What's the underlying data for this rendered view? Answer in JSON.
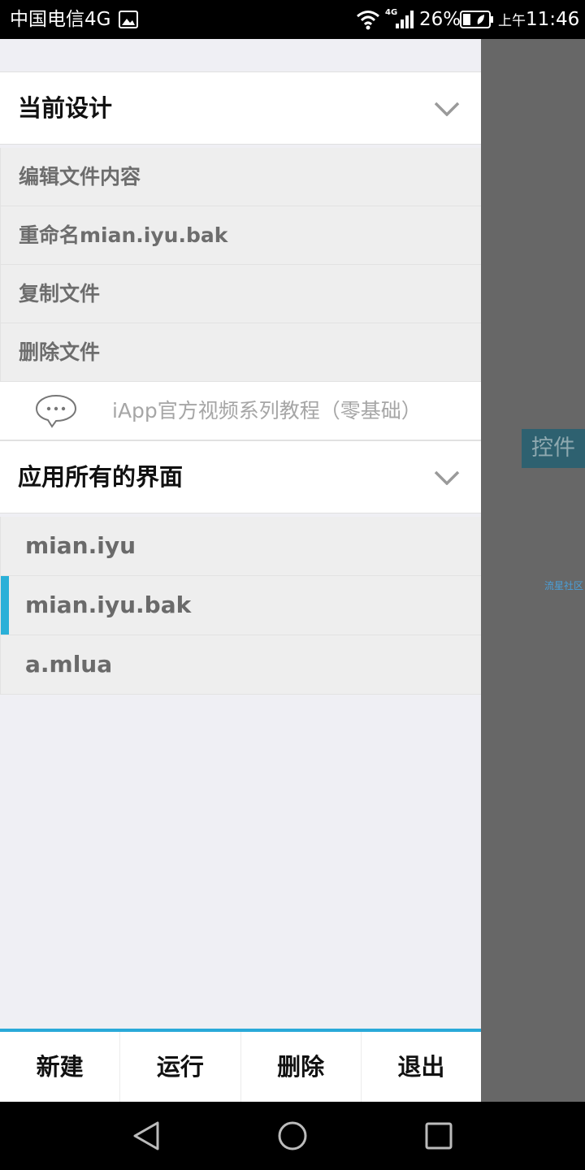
{
  "status_bar": {
    "carrier": "中国电信4G",
    "net_type": "4G",
    "battery": "26%",
    "time_ampm": "上午",
    "time": "11:46"
  },
  "drawer": {
    "current_design": {
      "title": "当前设计",
      "items": [
        {
          "label": "编辑文件内容"
        },
        {
          "label": "重命名mian.iyu.bak"
        },
        {
          "label": "复制文件"
        },
        {
          "label": "删除文件"
        }
      ]
    },
    "promo": {
      "label": "iApp官方视频系列教程（零基础）"
    },
    "all_screens": {
      "title": "应用所有的界面",
      "files": [
        {
          "label": "mian.iyu",
          "selected": false
        },
        {
          "label": "mian.iyu.bak",
          "selected": true
        },
        {
          "label": "a.mlua",
          "selected": false
        }
      ]
    }
  },
  "toolbar": {
    "new_label": "新建",
    "run_label": "运行",
    "delete_label": "删除",
    "exit_label": "退出"
  },
  "main_area": {
    "control_tab": "控件",
    "community_link": "流星社区"
  },
  "colors": {
    "accent": "#2aa9d9",
    "selected_bar": "#2ab0d8",
    "overlay": "#676767"
  }
}
